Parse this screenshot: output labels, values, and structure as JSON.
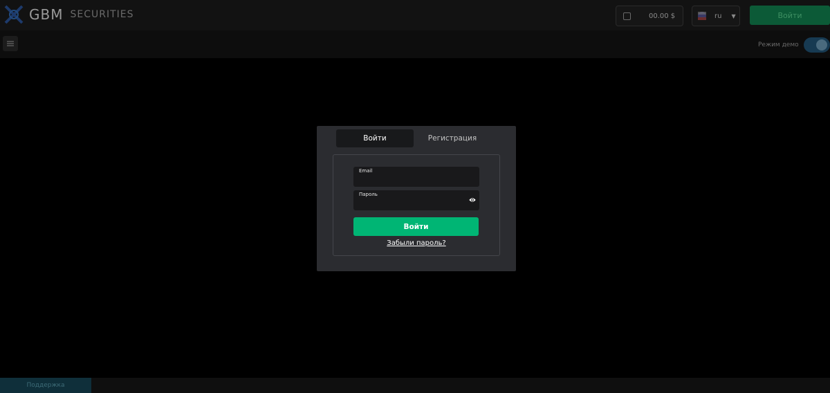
{
  "header": {
    "logo_text": "GBM",
    "logo_subtext": "SECURITIES",
    "balance_text": "00.00 $",
    "lang_code": "ru",
    "primary_button": "Войти"
  },
  "subheader": {
    "demo_label": "Режим демо"
  },
  "footer": {
    "button_label": "Поддержка"
  },
  "modal": {
    "tabs": [
      {
        "label": "Войти",
        "active": true
      },
      {
        "label": "Регистрация",
        "active": false
      }
    ],
    "email_label": "Email",
    "password_label": "Пароль",
    "submit_label": "Войти",
    "forgot_label": "Забыли пароль?"
  },
  "colors": {
    "accent": "#00b574",
    "modal_bg": "#2b2c30",
    "field_bg": "#19191b"
  }
}
